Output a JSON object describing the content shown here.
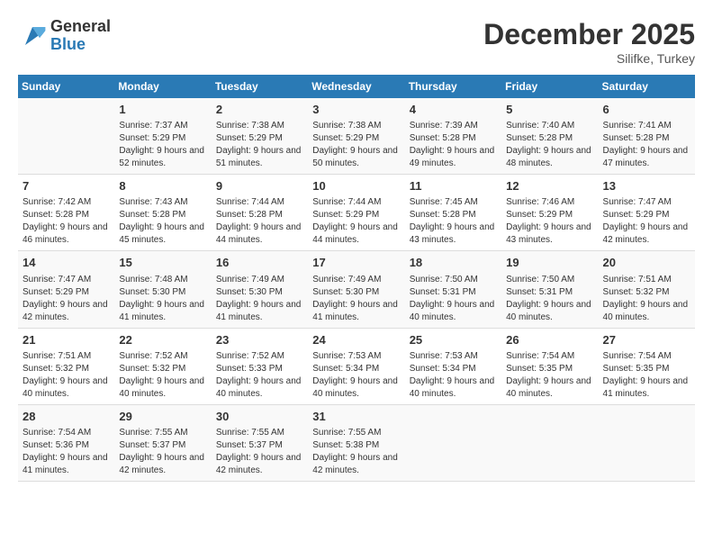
{
  "logo": {
    "general": "General",
    "blue": "Blue"
  },
  "title": "December 2025",
  "location": "Silifke, Turkey",
  "days_of_week": [
    "Sunday",
    "Monday",
    "Tuesday",
    "Wednesday",
    "Thursday",
    "Friday",
    "Saturday"
  ],
  "weeks": [
    [
      {
        "day": "",
        "info": ""
      },
      {
        "day": "1",
        "info": "Sunrise: 7:37 AM\nSunset: 5:29 PM\nDaylight: 9 hours and 52 minutes."
      },
      {
        "day": "2",
        "info": "Sunrise: 7:38 AM\nSunset: 5:29 PM\nDaylight: 9 hours and 51 minutes."
      },
      {
        "day": "3",
        "info": "Sunrise: 7:38 AM\nSunset: 5:29 PM\nDaylight: 9 hours and 50 minutes."
      },
      {
        "day": "4",
        "info": "Sunrise: 7:39 AM\nSunset: 5:28 PM\nDaylight: 9 hours and 49 minutes."
      },
      {
        "day": "5",
        "info": "Sunrise: 7:40 AM\nSunset: 5:28 PM\nDaylight: 9 hours and 48 minutes."
      },
      {
        "day": "6",
        "info": "Sunrise: 7:41 AM\nSunset: 5:28 PM\nDaylight: 9 hours and 47 minutes."
      }
    ],
    [
      {
        "day": "7",
        "info": "Sunrise: 7:42 AM\nSunset: 5:28 PM\nDaylight: 9 hours and 46 minutes."
      },
      {
        "day": "8",
        "info": "Sunrise: 7:43 AM\nSunset: 5:28 PM\nDaylight: 9 hours and 45 minutes."
      },
      {
        "day": "9",
        "info": "Sunrise: 7:44 AM\nSunset: 5:28 PM\nDaylight: 9 hours and 44 minutes."
      },
      {
        "day": "10",
        "info": "Sunrise: 7:44 AM\nSunset: 5:29 PM\nDaylight: 9 hours and 44 minutes."
      },
      {
        "day": "11",
        "info": "Sunrise: 7:45 AM\nSunset: 5:28 PM\nDaylight: 9 hours and 43 minutes."
      },
      {
        "day": "12",
        "info": "Sunrise: 7:46 AM\nSunset: 5:29 PM\nDaylight: 9 hours and 43 minutes."
      },
      {
        "day": "13",
        "info": "Sunrise: 7:47 AM\nSunset: 5:29 PM\nDaylight: 9 hours and 42 minutes."
      }
    ],
    [
      {
        "day": "14",
        "info": "Sunrise: 7:47 AM\nSunset: 5:29 PM\nDaylight: 9 hours and 42 minutes."
      },
      {
        "day": "15",
        "info": "Sunrise: 7:48 AM\nSunset: 5:30 PM\nDaylight: 9 hours and 41 minutes."
      },
      {
        "day": "16",
        "info": "Sunrise: 7:49 AM\nSunset: 5:30 PM\nDaylight: 9 hours and 41 minutes."
      },
      {
        "day": "17",
        "info": "Sunrise: 7:49 AM\nSunset: 5:30 PM\nDaylight: 9 hours and 41 minutes."
      },
      {
        "day": "18",
        "info": "Sunrise: 7:50 AM\nSunset: 5:31 PM\nDaylight: 9 hours and 40 minutes."
      },
      {
        "day": "19",
        "info": "Sunrise: 7:50 AM\nSunset: 5:31 PM\nDaylight: 9 hours and 40 minutes."
      },
      {
        "day": "20",
        "info": "Sunrise: 7:51 AM\nSunset: 5:32 PM\nDaylight: 9 hours and 40 minutes."
      }
    ],
    [
      {
        "day": "21",
        "info": "Sunrise: 7:51 AM\nSunset: 5:32 PM\nDaylight: 9 hours and 40 minutes."
      },
      {
        "day": "22",
        "info": "Sunrise: 7:52 AM\nSunset: 5:32 PM\nDaylight: 9 hours and 40 minutes."
      },
      {
        "day": "23",
        "info": "Sunrise: 7:52 AM\nSunset: 5:33 PM\nDaylight: 9 hours and 40 minutes."
      },
      {
        "day": "24",
        "info": "Sunrise: 7:53 AM\nSunset: 5:34 PM\nDaylight: 9 hours and 40 minutes."
      },
      {
        "day": "25",
        "info": "Sunrise: 7:53 AM\nSunset: 5:34 PM\nDaylight: 9 hours and 40 minutes."
      },
      {
        "day": "26",
        "info": "Sunrise: 7:54 AM\nSunset: 5:35 PM\nDaylight: 9 hours and 40 minutes."
      },
      {
        "day": "27",
        "info": "Sunrise: 7:54 AM\nSunset: 5:35 PM\nDaylight: 9 hours and 41 minutes."
      }
    ],
    [
      {
        "day": "28",
        "info": "Sunrise: 7:54 AM\nSunset: 5:36 PM\nDaylight: 9 hours and 41 minutes."
      },
      {
        "day": "29",
        "info": "Sunrise: 7:55 AM\nSunset: 5:37 PM\nDaylight: 9 hours and 42 minutes."
      },
      {
        "day": "30",
        "info": "Sunrise: 7:55 AM\nSunset: 5:37 PM\nDaylight: 9 hours and 42 minutes."
      },
      {
        "day": "31",
        "info": "Sunrise: 7:55 AM\nSunset: 5:38 PM\nDaylight: 9 hours and 42 minutes."
      },
      {
        "day": "",
        "info": ""
      },
      {
        "day": "",
        "info": ""
      },
      {
        "day": "",
        "info": ""
      }
    ]
  ]
}
